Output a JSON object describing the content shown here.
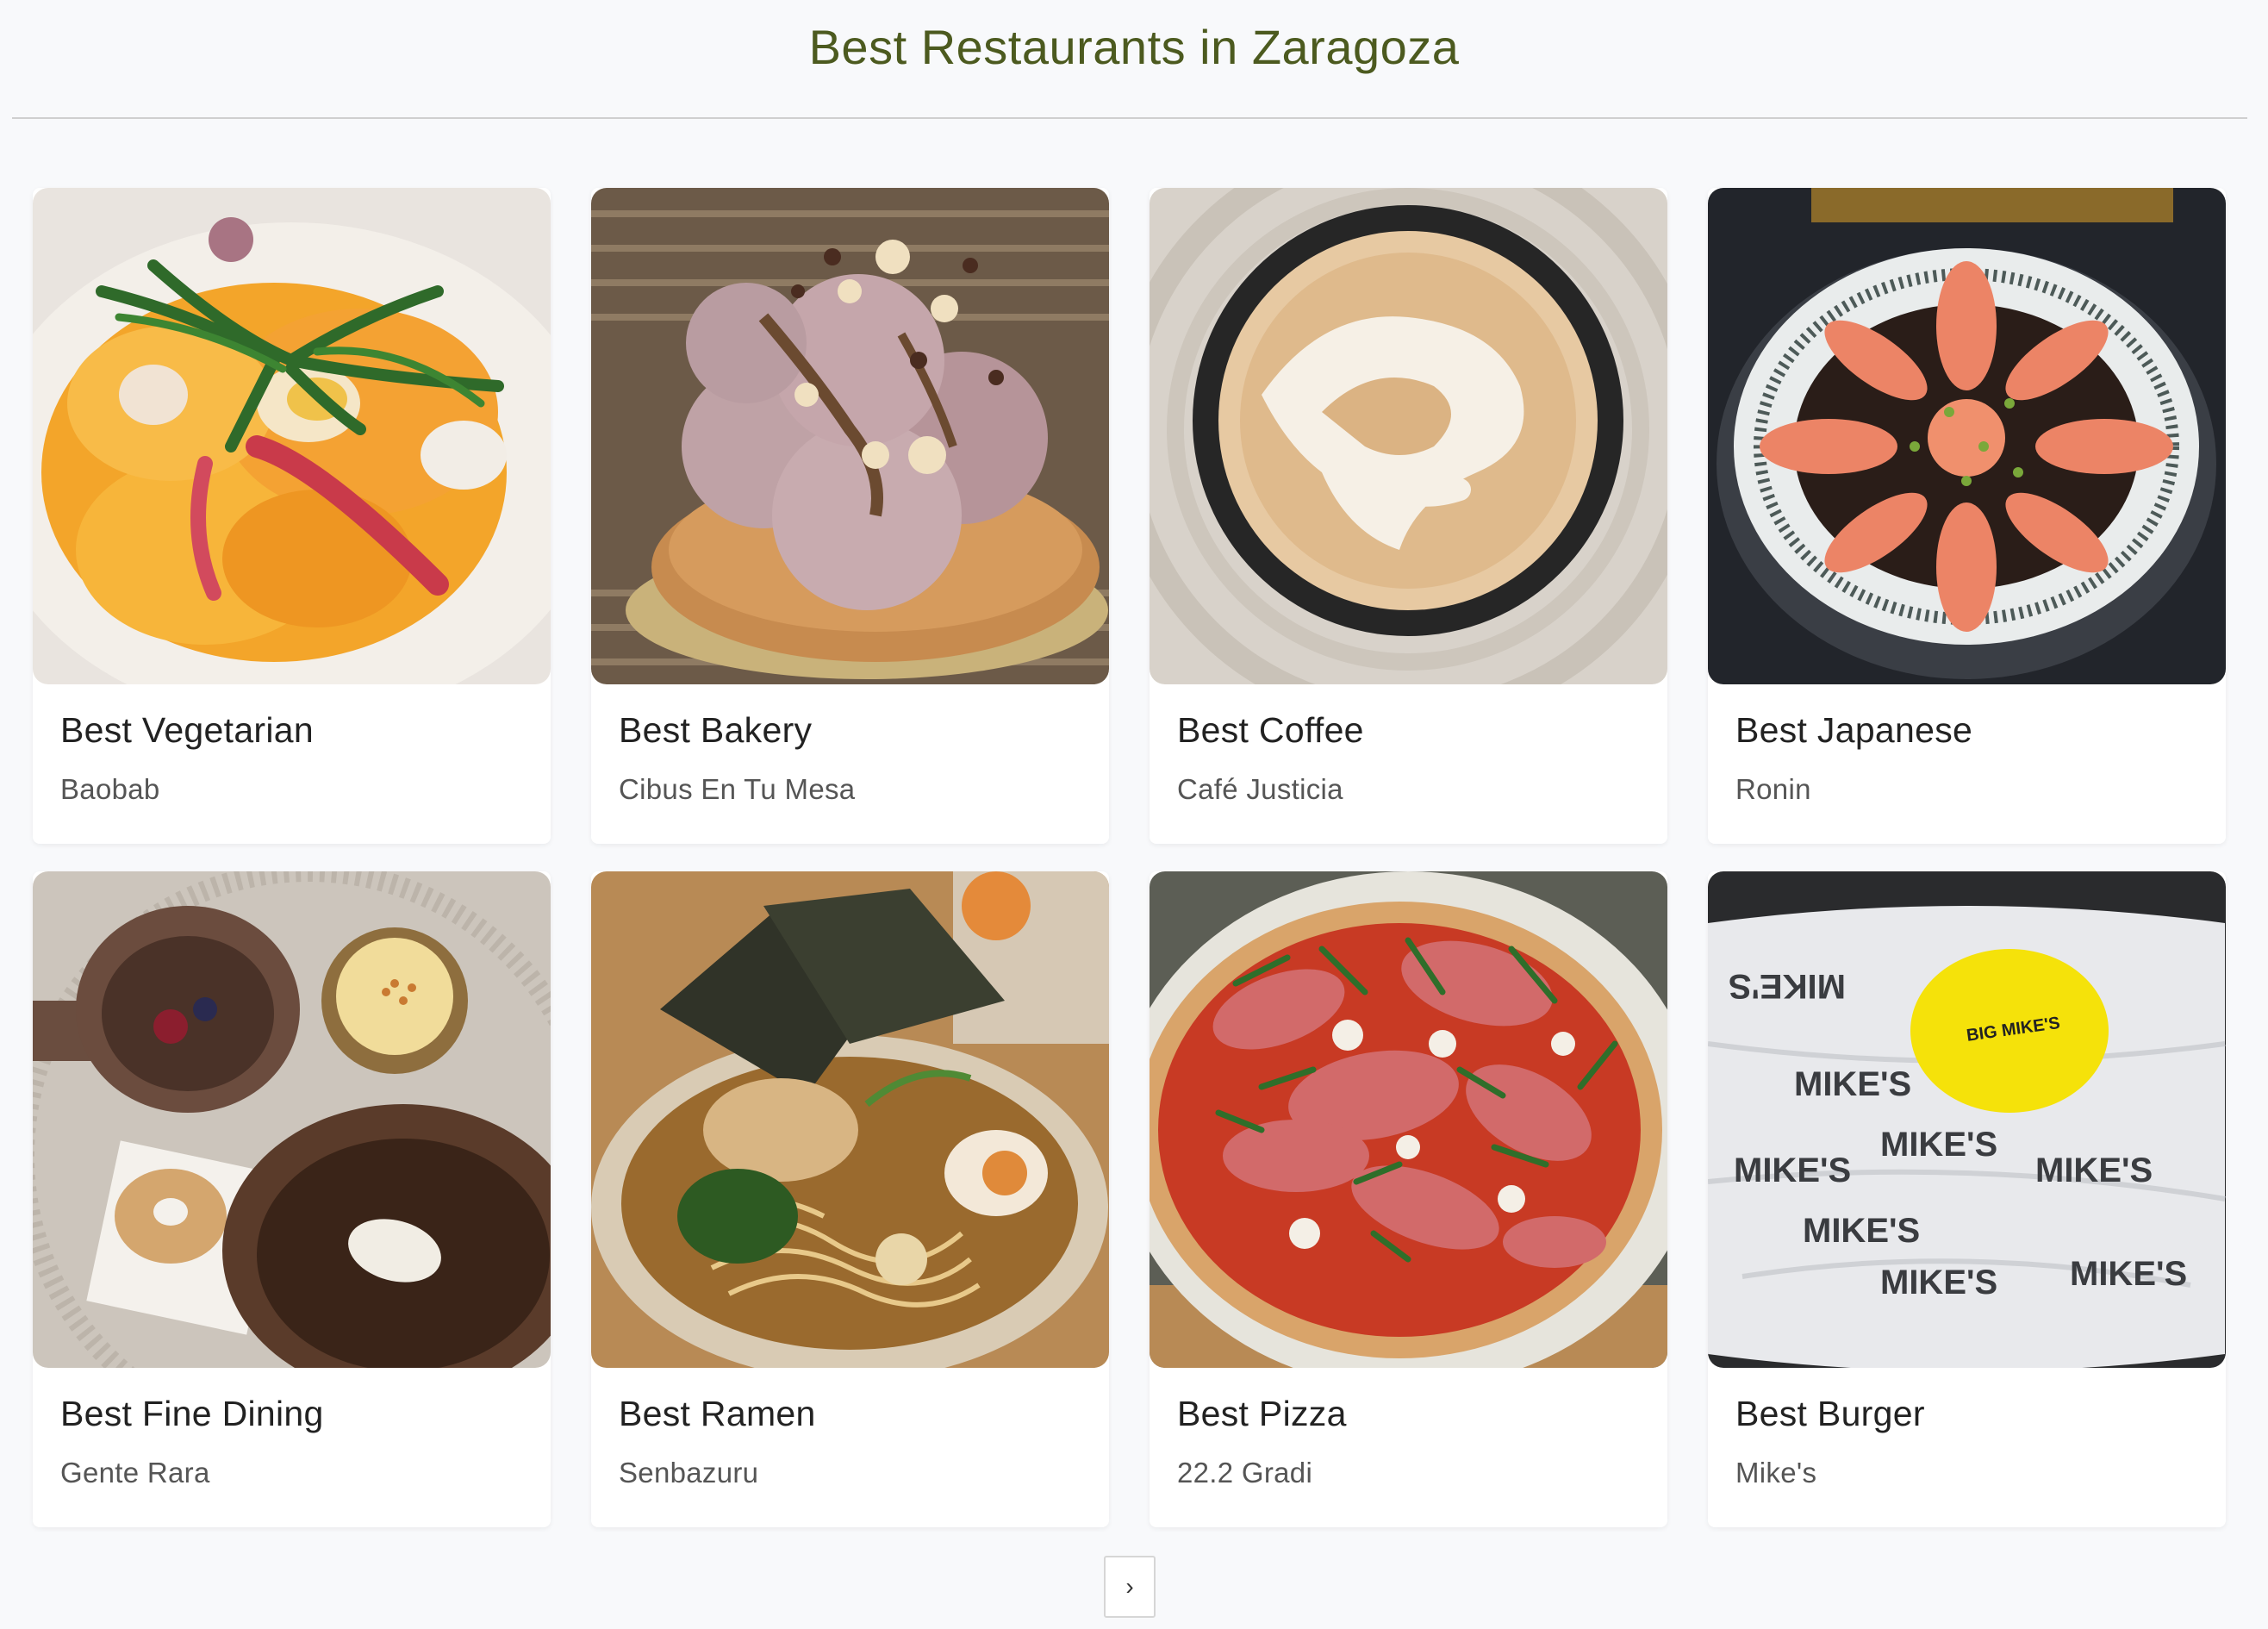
{
  "page": {
    "title": "Best Restaurants in Zaragoza"
  },
  "cards": [
    {
      "title": "Best Vegetarian",
      "name": "Baobab",
      "photo": "vegetarian-dish-photo"
    },
    {
      "title": "Best Bakery",
      "name": "Cibus En Tu Mesa",
      "photo": "pastry-tart-photo"
    },
    {
      "title": "Best Coffee",
      "name": "Café Justicia",
      "photo": "latte-art-photo"
    },
    {
      "title": "Best Japanese",
      "name": "Ronin",
      "photo": "salmon-plate-photo"
    },
    {
      "title": "Best Fine Dining",
      "name": "Gente Rara",
      "photo": "tasting-menu-photo"
    },
    {
      "title": "Best Ramen",
      "name": "Senbazuru",
      "photo": "ramen-bowl-photo"
    },
    {
      "title": "Best Pizza",
      "name": "22.2 Gradi",
      "photo": "prosciutto-pizza-photo"
    },
    {
      "title": "Best Burger",
      "name": "Mike's",
      "photo": "burger-wrap-photo"
    }
  ],
  "burger_wrap_text": {
    "sticker": "BIG MIKE'S",
    "print": "MIKE'S"
  },
  "pagination": {
    "next_icon": "chevron-right-icon",
    "next_label": "›"
  },
  "colors": {
    "title": "#4c5a1f",
    "background": "#f8f9fb"
  }
}
